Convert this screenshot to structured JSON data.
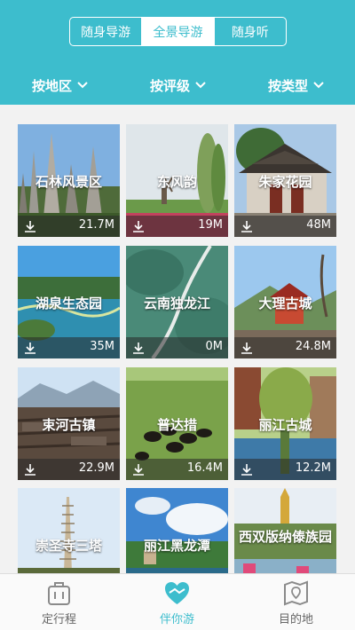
{
  "header": {
    "segments": [
      {
        "label": "随身导游",
        "active": false
      },
      {
        "label": "全景导游",
        "active": true
      },
      {
        "label": "随身听",
        "active": false
      }
    ],
    "filters": [
      {
        "label": "按地区",
        "icon": "chevron-down-icon"
      },
      {
        "label": "按评级",
        "icon": "chevron-down-icon"
      },
      {
        "label": "按类型",
        "icon": "chevron-down-icon"
      }
    ]
  },
  "attractions": [
    {
      "name": "石林风景区",
      "size": "21.7M"
    },
    {
      "name": "东风韵",
      "size": "19M"
    },
    {
      "name": "朱家花园",
      "size": "48M"
    },
    {
      "name": "湖泉生态园",
      "size": "35M"
    },
    {
      "name": "云南独龙江",
      "size": "0M"
    },
    {
      "name": "大理古城",
      "size": "24.8M"
    },
    {
      "name": "束河古镇",
      "size": "22.9M"
    },
    {
      "name": "普达措",
      "size": "16.4M"
    },
    {
      "name": "丽江古城",
      "size": "12.2M"
    },
    {
      "name": "崇圣寺三塔",
      "size": ""
    },
    {
      "name": "丽江黑龙潭",
      "size": ""
    },
    {
      "name": "西双版纳傣族园",
      "size": ""
    }
  ],
  "tabbar": {
    "tabs": [
      {
        "label": "定行程",
        "icon": "suitcase-icon",
        "active": false
      },
      {
        "label": "伴你游",
        "icon": "heart-hands-icon",
        "active": true
      },
      {
        "label": "目的地",
        "icon": "map-pin-icon",
        "active": false
      }
    ]
  },
  "colors": {
    "accent": "#3dbdcd",
    "header_bg": "#3dbdcd",
    "page_bg": "#f2f2f2"
  }
}
